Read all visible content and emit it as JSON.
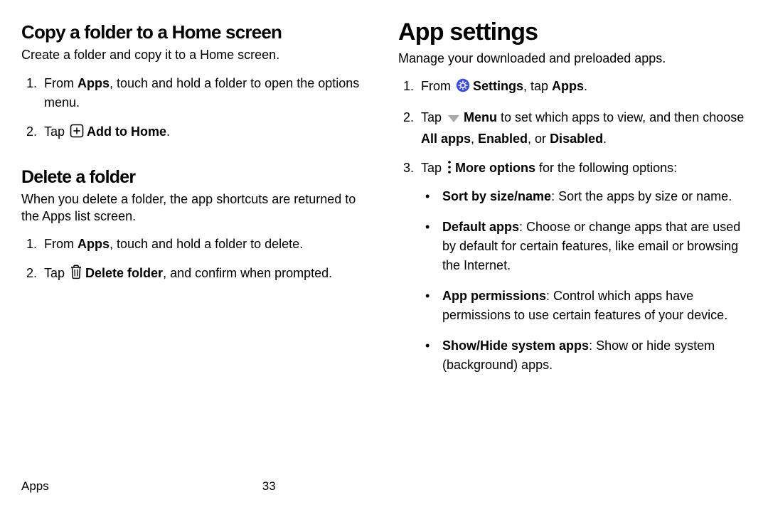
{
  "left": {
    "copy": {
      "heading": "Copy a folder to a Home screen",
      "intro": "Create a folder and copy it to a Home screen.",
      "s1a": "From ",
      "s1b": "Apps",
      "s1c": ", touch and hold a folder to open the options menu.",
      "s2a": "Tap ",
      "s2b": "Add to Home",
      "s2c": "."
    },
    "delete": {
      "heading": "Delete a folder",
      "intro": "When you delete a folder, the app shortcuts are returned to the Apps list screen.",
      "s1a": "From ",
      "s1b": "Apps",
      "s1c": ", touch and hold a folder to delete.",
      "s2a": "Tap ",
      "s2b": "Delete folder",
      "s2c": ", and confirm when prompted."
    }
  },
  "right": {
    "heading": "App settings",
    "intro": "Manage your downloaded and preloaded apps.",
    "s1a": "From ",
    "s1b": "Settings",
    "s1c": ", tap ",
    "s1d": "Apps",
    "s1e": ".",
    "s2a": "Tap ",
    "s2b": "Menu",
    "s2c": " to set which apps to view, and then choose ",
    "s2d": "All apps",
    "s2e": ", ",
    "s2f": "Enabled",
    "s2g": ", or ",
    "s2h": "Disabled",
    "s2i": ".",
    "s3a": "Tap ",
    "s3b": "More options",
    "s3c": " for the following options:",
    "b1a": "Sort by size/name",
    "b1b": ": Sort the apps by size or name.",
    "b2a": "Default apps",
    "b2b": ": Choose or change apps that are used by default for certain features, like email or browsing the Internet.",
    "b3a": "App permissions",
    "b3b": ": Control which apps have permissions to use certain features of your device.",
    "b4a": "Show/Hide system apps",
    "b4b": ": Show or hide system (background) apps."
  },
  "footer": {
    "section": "Apps",
    "page": "33"
  }
}
